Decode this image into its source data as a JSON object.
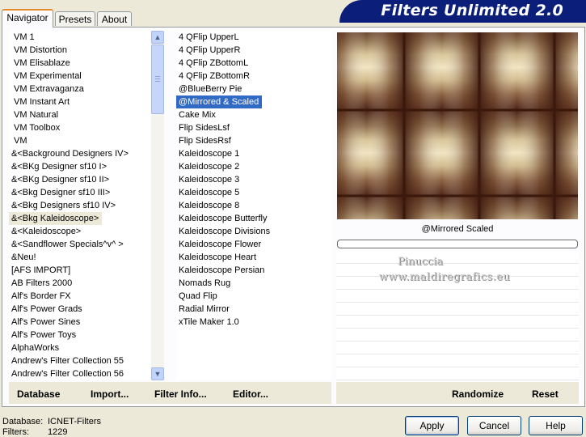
{
  "tabs": [
    {
      "label": "Navigator",
      "active": true
    },
    {
      "label": "Presets",
      "active": false
    },
    {
      "label": "About",
      "active": false
    }
  ],
  "banner_title": "Filters Unlimited 2.0",
  "categories": [
    "VM 1",
    "VM Distortion",
    "VM Elisablaze",
    "VM Experimental",
    "VM Extravaganza",
    "VM Instant Art",
    "VM Natural",
    "VM Toolbox",
    "VM",
    "&<Background Designers IV>",
    "&<BKg Designer sf10 I>",
    "&<BKg Designer sf10 II>",
    "&<Bkg Designer sf10 III>",
    "&<Bkg Designers sf10 IV>",
    "&<Bkg Kaleidoscope>",
    "&<Kaleidoscope>",
    "&<Sandflower Specials^v^ >",
    "&Neu!",
    "[AFS IMPORT]",
    "AB Filters 2000",
    "Alf's Border FX",
    "Alf's Power Grads",
    "Alf's Power Sines",
    "Alf's Power Toys",
    "AlphaWorks",
    "Andrew's Filter Collection 55",
    "Andrew's Filter Collection 56"
  ],
  "selected_category": "&<Bkg Kaleidoscope>",
  "filters": [
    "4 QFlip UpperL",
    "4 QFlip UpperR",
    "4 QFlip ZBottomL",
    "4 QFlip ZBottomR",
    "@BlueBerry Pie",
    "@Mirrored & Scaled",
    "Cake Mix",
    "Flip SidesLsf",
    "Flip SidesRsf",
    "Kaleidoscope 1",
    "Kaleidoscope 2",
    "Kaleidoscope 3",
    "Kaleidoscope 5",
    "Kaleidoscope 8",
    "Kaleidoscope Butterfly",
    "Kaleidoscope Divisions",
    "Kaleidoscope Flower",
    "Kaleidoscope Heart",
    "Kaleidoscope Persian",
    "Nomads Rug",
    "Quad Flip",
    "Radial Mirror",
    "xTile Maker 1.0"
  ],
  "selected_filter": "@Mirrored & Scaled",
  "preview_title": "@Mirrored  Scaled",
  "watermark_line1": "Pinuccia",
  "watermark_line2": "www.maldiregrafics.eu",
  "bottom_left_buttons": {
    "database": "Database",
    "import": "Import...",
    "filter_info": "Filter Info...",
    "editor": "Editor..."
  },
  "bottom_right_buttons": {
    "randomize": "Randomize",
    "reset": "Reset"
  },
  "status": {
    "database_label": "Database:",
    "database_value": "ICNET-Filters",
    "filters_label": "Filters:",
    "filters_value": "1229"
  },
  "dialog_buttons": {
    "apply": "Apply",
    "cancel": "Cancel",
    "help": "Help"
  },
  "colors": {
    "banner": "#0a1e7a",
    "selection": "#316ac5",
    "preview_dark": "#4a2114",
    "preview_light": "#e8d6a8"
  }
}
